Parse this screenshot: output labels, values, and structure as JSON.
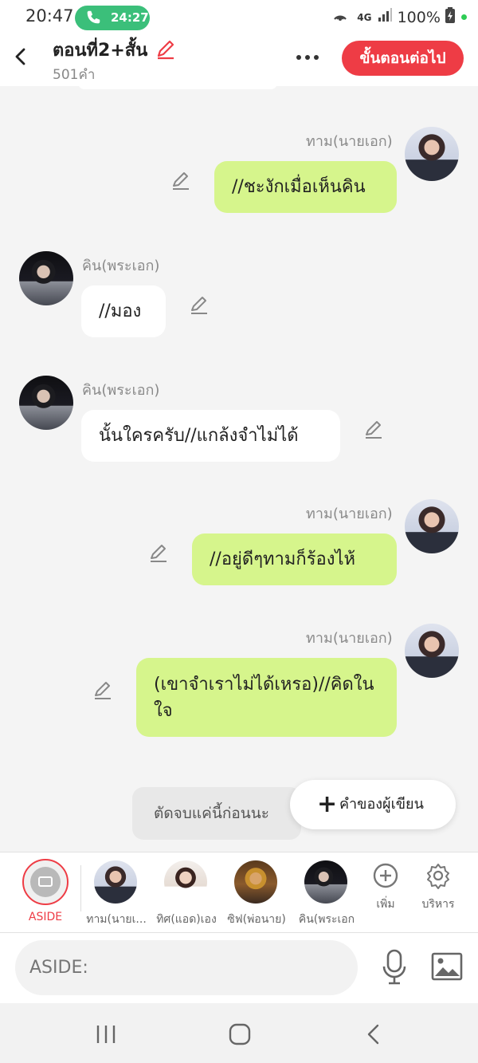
{
  "status_bar": {
    "time": "20:47",
    "call_timer": "24:27",
    "network": "4G",
    "battery": "100%"
  },
  "header": {
    "title": "ตอนที่2+สั้น",
    "word_count": "501คำ",
    "next_button": "ขั้นตอนต่อไป"
  },
  "messages": [
    {
      "speaker": "ทาม(นายเอก)",
      "text": "//ชะงักเมื่อเห็นคิน",
      "side": "right"
    },
    {
      "speaker": "คิน(พระเอก)",
      "text": "//มอง",
      "side": "left"
    },
    {
      "speaker": "คิน(พระเอก)",
      "text": "นั้นใครครับ//แกล้งจำไม่ได้",
      "side": "left"
    },
    {
      "speaker": "ทาม(นายเอก)",
      "text": "//อยู่ดีๆทามก็ร้องไห้",
      "side": "right"
    },
    {
      "speaker": "ทาม(นายเอก)",
      "text": "(เขาจำเราไม่ได้เหรอ)//คิดในใจ",
      "side": "right"
    }
  ],
  "aside_note": "ตัดจบแค่นี้ก่อนนะ",
  "author_button": "คำของผู้เขียน",
  "character_bar": {
    "aside_label": "ASIDE",
    "characters": [
      {
        "name": "ทาม(นายเ..."
      },
      {
        "name": "ทิศ(แอด)เอง"
      },
      {
        "name": "ซิฟ(พ่อนาย)"
      },
      {
        "name": "คิน(พระเอก"
      }
    ],
    "add_label": "เพิ่ม",
    "manage_label": "บริหาร"
  },
  "input": {
    "placeholder": "ASIDE:"
  },
  "colors": {
    "accent": "#ee3c45",
    "bubble_right": "#d6f58c",
    "bubble_left": "#ffffff",
    "call_pill": "#3bbf7a"
  }
}
